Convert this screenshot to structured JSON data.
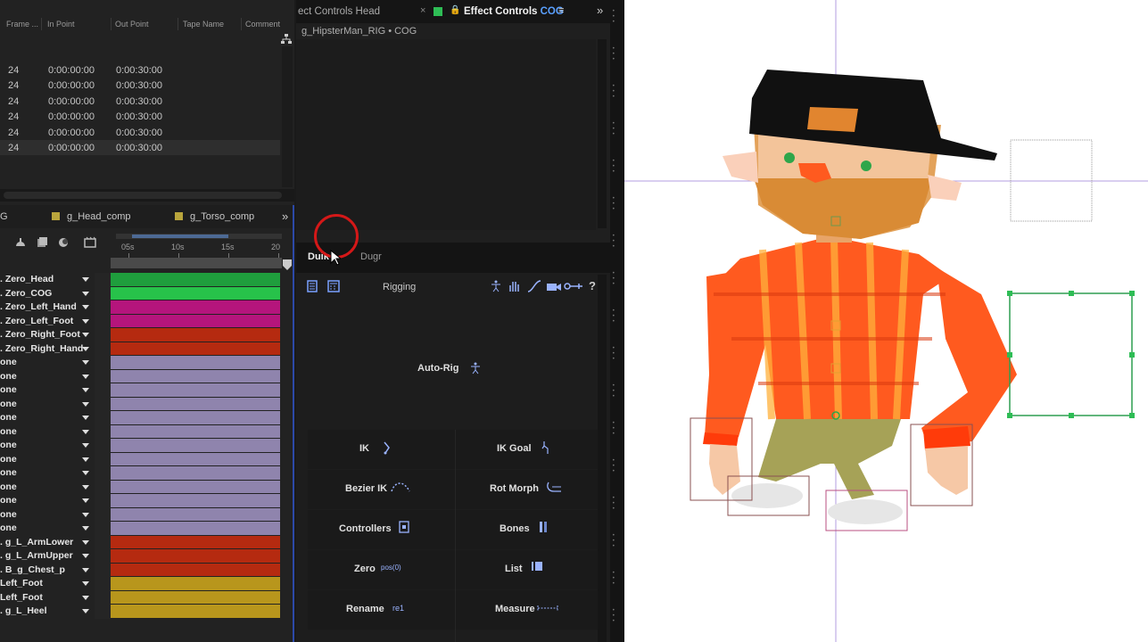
{
  "project": {
    "columns": [
      "Frame ...",
      "In Point",
      "Out Point",
      "Tape Name",
      "Comment"
    ],
    "rows": [
      {
        "frame": "24",
        "in": "0:00:00:00",
        "out": "0:00:30:00"
      },
      {
        "frame": "24",
        "in": "0:00:00:00",
        "out": "0:00:30:00"
      },
      {
        "frame": "24",
        "in": "0:00:00:00",
        "out": "0:00:30:00"
      },
      {
        "frame": "24",
        "in": "0:00:00:00",
        "out": "0:00:30:00"
      },
      {
        "frame": "24",
        "in": "0:00:00:00",
        "out": "0:00:30:00"
      },
      {
        "frame": "24",
        "in": "0:00:00:00",
        "out": "0:00:30:00"
      }
    ]
  },
  "timeline": {
    "tabs": [
      "G",
      "g_Head_comp",
      "g_Torso_comp"
    ],
    "more": "»",
    "ruler_labels": [
      "05s",
      "10s",
      "15s",
      "20"
    ],
    "layers": [
      {
        "name": ". Zero_Head",
        "color": "#1f9e3d"
      },
      {
        "name": ". Zero_COG",
        "color": "#27c24a"
      },
      {
        "name": ". Zero_Left_Hand",
        "color": "#b5157c"
      },
      {
        "name": ". Zero_Left_Foot",
        "color": "#b5157c"
      },
      {
        "name": ". Zero_Right_Foot",
        "color": "#b52a10"
      },
      {
        "name": ". Zero_Right_Hand",
        "color": "#b52a10"
      },
      {
        "name": "one",
        "color": "#8f84ad"
      },
      {
        "name": "one",
        "color": "#8f84ad"
      },
      {
        "name": "one",
        "color": "#8f84ad"
      },
      {
        "name": "one",
        "color": "#8f84ad"
      },
      {
        "name": "one",
        "color": "#8f84ad"
      },
      {
        "name": "one",
        "color": "#8f84ad"
      },
      {
        "name": "one",
        "color": "#8f84ad"
      },
      {
        "name": "one",
        "color": "#8f84ad"
      },
      {
        "name": "one",
        "color": "#8f84ad"
      },
      {
        "name": "one",
        "color": "#8f84ad"
      },
      {
        "name": "one",
        "color": "#8f84ad"
      },
      {
        "name": "one",
        "color": "#8f84ad"
      },
      {
        "name": "one",
        "color": "#8f84ad"
      },
      {
        "name": ". g_L_ArmLower",
        "color": "#b52a10"
      },
      {
        "name": ". g_L_ArmUpper",
        "color": "#b52a10"
      },
      {
        "name": ". B_g_Chest_p",
        "color": "#b52a10"
      },
      {
        "name": "Left_Foot",
        "color": "#b8961c"
      },
      {
        "name": "Left_Foot",
        "color": "#b8961c"
      },
      {
        "name": ". g_L_Heel",
        "color": "#b8961c"
      }
    ]
  },
  "effect_controls": {
    "tab_inactive": "ect Controls Head",
    "tab_active_prefix": "Effect Controls ",
    "tab_active_layer": "COG",
    "close": "×",
    "menu": "≡",
    "more": "»",
    "subtitle": "g_HipsterMan_RIG • COG"
  },
  "duik": {
    "tab_active": "Duik",
    "tab_inactive": "Dugr",
    "section": "Rigging",
    "autorig": "Auto-Rig",
    "help": "?",
    "tools": [
      {
        "label": "IK",
        "side": "left"
      },
      {
        "label": "IK Goal",
        "side": "right"
      },
      {
        "label": "Bezier IK",
        "side": "left"
      },
      {
        "label": "Rot Morph",
        "side": "right"
      },
      {
        "label": "Controllers",
        "side": "left"
      },
      {
        "label": "Bones",
        "side": "right"
      },
      {
        "label": "Zero",
        "side": "left"
      },
      {
        "label": "List",
        "side": "right"
      },
      {
        "label": "Rename",
        "side": "left"
      },
      {
        "label": "Measure",
        "side": "right"
      }
    ],
    "zero_icon_text": "pos(0)",
    "rename_icon_text": "re1"
  },
  "colors": {
    "accent_blue": "#5aa0ff",
    "cursor_circle": "#d41818",
    "selection_green": "#2ebd55"
  }
}
